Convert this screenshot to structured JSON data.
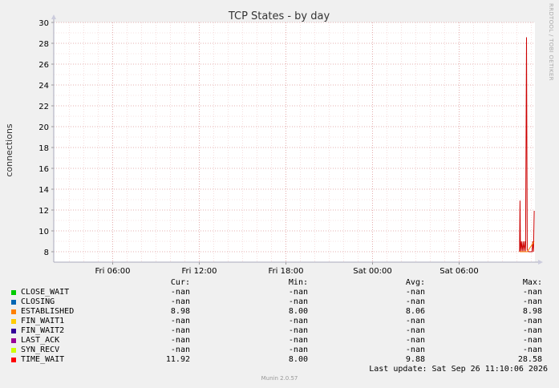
{
  "chart_data": {
    "type": "line",
    "title": "TCP States - by day",
    "ylabel": "connections",
    "xlabel": "",
    "ylim": [
      7,
      30
    ],
    "yticks": [
      8,
      10,
      12,
      14,
      16,
      18,
      20,
      22,
      24,
      26,
      28,
      30
    ],
    "xticks": [
      "Fri 06:00",
      "Fri 12:00",
      "Fri 18:00",
      "Sat 00:00",
      "Sat 06:00"
    ],
    "grid": true,
    "series": [
      {
        "name": "TIME_WAIT",
        "color": "#cc0000",
        "points": [
          {
            "x": 0.968,
            "y": 8.0
          },
          {
            "x": 0.969,
            "y": 12.9
          },
          {
            "x": 0.97,
            "y": 8.0
          },
          {
            "x": 0.972,
            "y": 9.0
          },
          {
            "x": 0.9735,
            "y": 8.0
          },
          {
            "x": 0.9755,
            "y": 9.0
          },
          {
            "x": 0.977,
            "y": 8.0
          },
          {
            "x": 0.979,
            "y": 9.0
          },
          {
            "x": 0.9805,
            "y": 8.0
          },
          {
            "x": 0.9825,
            "y": 28.58
          },
          {
            "x": 0.984,
            "y": 8.2
          },
          {
            "x": 0.987,
            "y": 8.0
          },
          {
            "x": 0.994,
            "y": 8.0
          },
          {
            "x": 0.9955,
            "y": 9.0
          },
          {
            "x": 0.997,
            "y": 8.0
          },
          {
            "x": 0.9985,
            "y": 11.92
          }
        ]
      },
      {
        "name": "ESTABLISHED",
        "color": "#ff7f00",
        "points": [
          {
            "x": 0.968,
            "y": 8.0
          },
          {
            "x": 0.97,
            "y": 8.0
          },
          {
            "x": 0.9735,
            "y": 8.0
          },
          {
            "x": 0.977,
            "y": 8.0
          },
          {
            "x": 0.9805,
            "y": 8.0
          },
          {
            "x": 0.984,
            "y": 8.0
          },
          {
            "x": 0.9985,
            "y": 8.98
          }
        ]
      }
    ]
  },
  "legend": {
    "headers": {
      "cur": "Cur:",
      "min": "Min:",
      "avg": "Avg:",
      "max": "Max:"
    },
    "rows": [
      {
        "name": "CLOSE_WAIT",
        "color": "#00cc00",
        "cur": "-nan",
        "min": "-nan",
        "avg": "-nan",
        "max": "-nan"
      },
      {
        "name": "CLOSING",
        "color": "#0066b3",
        "cur": "-nan",
        "min": "-nan",
        "avg": "-nan",
        "max": "-nan"
      },
      {
        "name": "ESTABLISHED",
        "color": "#ff8000",
        "cur": "8.98",
        "min": "8.00",
        "avg": "8.06",
        "max": "8.98"
      },
      {
        "name": "FIN_WAIT1",
        "color": "#ffcc00",
        "cur": "-nan",
        "min": "-nan",
        "avg": "-nan",
        "max": "-nan"
      },
      {
        "name": "FIN_WAIT2",
        "color": "#330099",
        "cur": "-nan",
        "min": "-nan",
        "avg": "-nan",
        "max": "-nan"
      },
      {
        "name": "LAST_ACK",
        "color": "#990099",
        "cur": "-nan",
        "min": "-nan",
        "avg": "-nan",
        "max": "-nan"
      },
      {
        "name": "SYN_RECV",
        "color": "#ccff00",
        "cur": "-nan",
        "min": "-nan",
        "avg": "-nan",
        "max": "-nan"
      },
      {
        "name": "TIME_WAIT",
        "color": "#ff0000",
        "cur": "11.92",
        "min": "8.00",
        "avg": "9.88",
        "max": "28.58"
      }
    ]
  },
  "last_update": "Last update: Sat Sep 26 11:10:06 2026",
  "footer": "Munin 2.0.57",
  "side_label": "RRDTOOL / TOBI OETIKER"
}
